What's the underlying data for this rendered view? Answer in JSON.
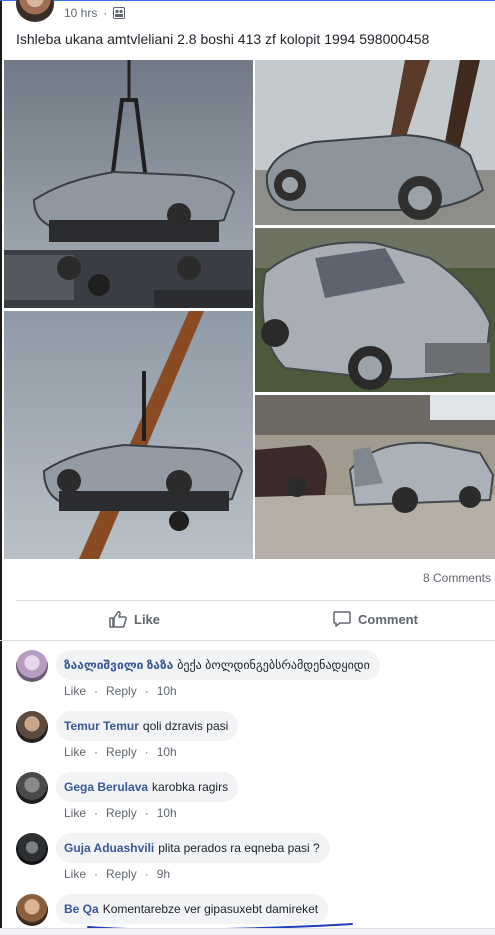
{
  "post": {
    "time": "10 hrs",
    "privacy_icon": "friends-icon",
    "text": "Ishleba ukana amtvleliani 2.8 boshi 413 zf kolopit 1994 598000458"
  },
  "photos": [
    {
      "name": "photo-crane-lift-1",
      "description_icon": "car-on-crane"
    },
    {
      "name": "photo-damaged-car-top",
      "description_icon": "car-on-crane"
    },
    {
      "name": "photo-damaged-car-front",
      "description_icon": "wrecked-car"
    },
    {
      "name": "photo-crane-lift-2",
      "description_icon": "car-on-crane"
    },
    {
      "name": "photo-yard-cars",
      "description_icon": "cars-in-yard"
    }
  ],
  "stats": {
    "comments_count": "8 Comments"
  },
  "actions": {
    "like_label": "Like",
    "comment_label": "Comment"
  },
  "comments": [
    {
      "name": "ზაალიშვილი ზაზა",
      "text": "ბექა ბოლდინგებსრამდენადყიდი",
      "like": "Like",
      "reply": "Reply",
      "time": "10h"
    },
    {
      "name": "Temur Temur",
      "text": "qoli dzravis pasi",
      "like": "Like",
      "reply": "Reply",
      "time": "10h"
    },
    {
      "name": "Gega Berulava",
      "text": "karobka ragirs",
      "like": "Like",
      "reply": "Reply",
      "time": "10h"
    },
    {
      "name": "Guja Aduashvili",
      "text": "plita perados ra eqneba pasi ?",
      "like": "Like",
      "reply": "Reply",
      "time": "9h"
    },
    {
      "name": "Be Qa",
      "text": "Komentarebze ver gipasuxebt damireket"
    }
  ],
  "colors": {
    "accent": "#385898",
    "annotation": "#1f3fbf"
  }
}
